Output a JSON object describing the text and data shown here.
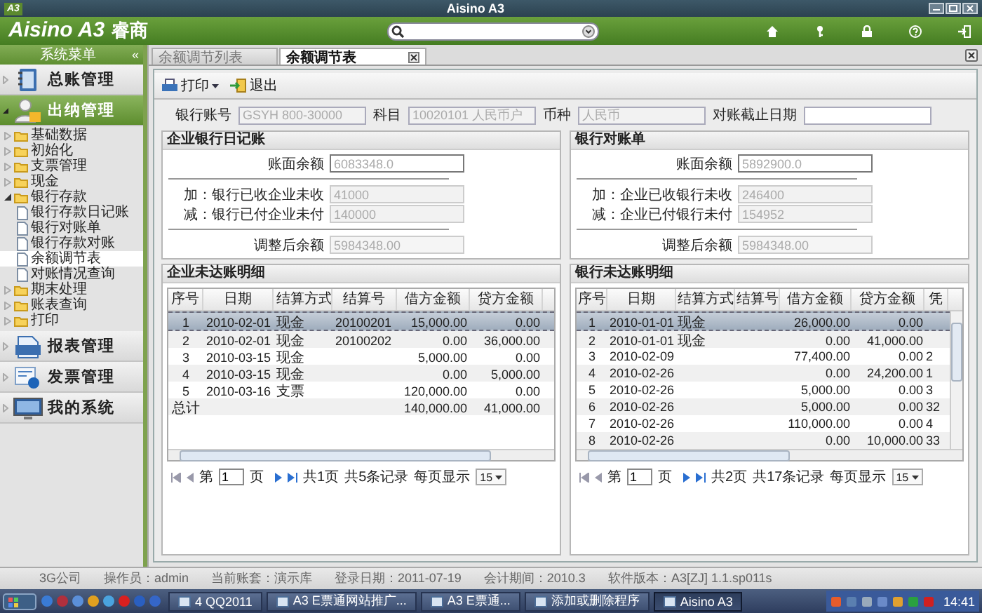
{
  "window": {
    "badge": "A3",
    "title": "Aisino A3"
  },
  "header": {
    "logo": "Aisino A3",
    "logo_cn": "睿商"
  },
  "sidebar": {
    "title": "系统菜单",
    "collapse": "«",
    "modules": [
      {
        "label": "总账管理",
        "expanded": false
      },
      {
        "label": "出纳管理",
        "expanded": true,
        "tree": [
          {
            "label": "基础数据",
            "kind": "folder",
            "expanded": false,
            "selected": false
          },
          {
            "label": "初始化",
            "kind": "folder",
            "expanded": false,
            "selected": false
          },
          {
            "label": "支票管理",
            "kind": "folder",
            "expanded": false,
            "selected": false
          },
          {
            "label": "现金",
            "kind": "folder",
            "expanded": false,
            "selected": false
          },
          {
            "label": "银行存款",
            "kind": "folder",
            "expanded": true,
            "selected": false,
            "children": [
              {
                "label": "银行存款日记账",
                "kind": "page",
                "selected": false
              },
              {
                "label": "银行对账单",
                "kind": "page",
                "selected": false
              },
              {
                "label": "银行存款对账",
                "kind": "page",
                "selected": false
              },
              {
                "label": "余额调节表",
                "kind": "page",
                "selected": true
              },
              {
                "label": "对账情况查询",
                "kind": "page",
                "selected": false
              }
            ]
          },
          {
            "label": "期末处理",
            "kind": "folder",
            "expanded": false,
            "selected": false
          },
          {
            "label": "账表查询",
            "kind": "folder",
            "expanded": false,
            "selected": false
          },
          {
            "label": "打印",
            "kind": "folder",
            "expanded": false,
            "selected": false
          }
        ]
      },
      {
        "label": "报表管理",
        "expanded": false
      },
      {
        "label": "发票管理",
        "expanded": false
      },
      {
        "label": "我的系统",
        "expanded": false
      }
    ]
  },
  "tabs": [
    {
      "label": "余额调节列表",
      "selected": false,
      "closable": false
    },
    {
      "label": "余额调节表",
      "selected": true,
      "closable": true
    }
  ],
  "toolbar": [
    {
      "label": "打印",
      "dropdown": true
    },
    {
      "label": "退出",
      "dropdown": false
    }
  ],
  "filters": [
    {
      "label": "银行账号",
      "value": "GSYH 800-30000",
      "disabled": true
    },
    {
      "label": "科目",
      "value": "10020101 人民币户",
      "disabled": true
    },
    {
      "label": "币种",
      "value": "人民币",
      "disabled": true
    },
    {
      "label": "对账截止日期",
      "disabled": false
    }
  ],
  "balances": [
    {
      "title": "企业银行日记账",
      "fields": [
        {
          "label": "账面余额",
          "value": "6083348.0",
          "kind": "balance"
        },
        {
          "label": "加：银行已收企业未收",
          "value": "41000",
          "kind": "adjustment"
        },
        {
          "label": "减：银行已付企业未付",
          "value": "140000",
          "kind": "adjustment"
        },
        {
          "label": "调整后余额",
          "value": "5984348.00",
          "kind": "result"
        }
      ]
    },
    {
      "title": "银行对账单",
      "fields": [
        {
          "label": "账面余额",
          "value": "5892900.0",
          "kind": "balance"
        },
        {
          "label": "加：企业已收银行未收",
          "value": "246400",
          "kind": "adjustment"
        },
        {
          "label": "减：企业已付银行未付",
          "value": "154952",
          "kind": "adjustment"
        },
        {
          "label": "调整后余额",
          "value": "5984348.00",
          "kind": "result"
        }
      ]
    }
  ],
  "details": [
    {
      "title": "企业未达账明细",
      "columns": [
        "序号",
        "日期",
        "结算方式",
        "结算号",
        "借方金额",
        "贷方金额"
      ],
      "rows": [
        {
          "no": "1",
          "date": "2010-02-01",
          "method": "现金",
          "ref": "20100201",
          "debit": "15,000.00",
          "credit": "0.00",
          "selected": true
        },
        {
          "no": "2",
          "date": "2010-02-01",
          "method": "现金",
          "ref": "20100202",
          "debit": "0.00",
          "credit": "36,000.00",
          "selected": false
        },
        {
          "no": "3",
          "date": "2010-03-15",
          "method": "现金",
          "debit": "5,000.00",
          "credit": "0.00",
          "selected": false
        },
        {
          "no": "4",
          "date": "2010-03-15",
          "method": "现金",
          "debit": "0.00",
          "credit": "5,000.00",
          "selected": false
        },
        {
          "no": "5",
          "date": "2010-03-16",
          "method": "支票",
          "debit": "120,000.00",
          "credit": "0.00",
          "selected": false
        }
      ],
      "total": {
        "label": "总计",
        "debit": "140,000.00",
        "credit": "41,000.00"
      },
      "pager": {
        "page_prefix": "第",
        "page": "1",
        "page_suffix": "页",
        "pages": "共1页",
        "records": "共5条记录",
        "size_label": "每页显示",
        "size": "15"
      }
    },
    {
      "title": "银行未达账明细",
      "columns": [
        "序号",
        "日期",
        "结算方式",
        "结算号",
        "借方金额",
        "贷方金额",
        "凭"
      ],
      "rows": [
        {
          "no": "1",
          "date": "2010-01-01",
          "method": "现金",
          "debit": "26,000.00",
          "credit": "0.00",
          "selected": true
        },
        {
          "no": "2",
          "date": "2010-01-01",
          "method": "现金",
          "debit": "0.00",
          "credit": "41,000.00",
          "selected": false
        },
        {
          "no": "3",
          "date": "2010-02-09",
          "debit": "77,400.00",
          "credit": "0.00",
          "voucher": "2",
          "selected": false
        },
        {
          "no": "4",
          "date": "2010-02-26",
          "debit": "0.00",
          "credit": "24,200.00",
          "voucher": "1",
          "selected": false
        },
        {
          "no": "5",
          "date": "2010-02-26",
          "debit": "5,000.00",
          "credit": "0.00",
          "voucher": "3",
          "selected": false
        },
        {
          "no": "6",
          "date": "2010-02-26",
          "debit": "5,000.00",
          "credit": "0.00",
          "voucher": "32",
          "selected": false
        },
        {
          "no": "7",
          "date": "2010-02-26",
          "debit": "110,000.00",
          "credit": "0.00",
          "voucher": "4",
          "selected": false
        },
        {
          "no": "8",
          "date": "2010-02-26",
          "debit": "0.00",
          "credit": "10,000.00",
          "voucher": "33",
          "selected": false
        }
      ],
      "pager": {
        "page_prefix": "第",
        "page": "1",
        "page_suffix": "页",
        "pages": "共2页",
        "records": "共17条记录",
        "size_label": "每页显示",
        "size": "15"
      }
    }
  ],
  "status_bar": [
    "3G公司",
    "操作员：admin",
    "当前账套：演示库",
    "登录日期：2011-07-19",
    "会计期间：2010.3",
    "软件版本：A3[ZJ] 1.1.sp011s"
  ],
  "taskbar": {
    "windows": [
      {
        "count": "4",
        "label": "QQ2011",
        "selected": false
      },
      {
        "label": "A3 E票通网站推广...",
        "selected": false
      },
      {
        "label": "A3 E票通...",
        "selected": false
      },
      {
        "label": "添加或删除程序",
        "selected": false
      },
      {
        "label": "Aisino A3",
        "selected": true
      }
    ],
    "clock": "14:41"
  }
}
